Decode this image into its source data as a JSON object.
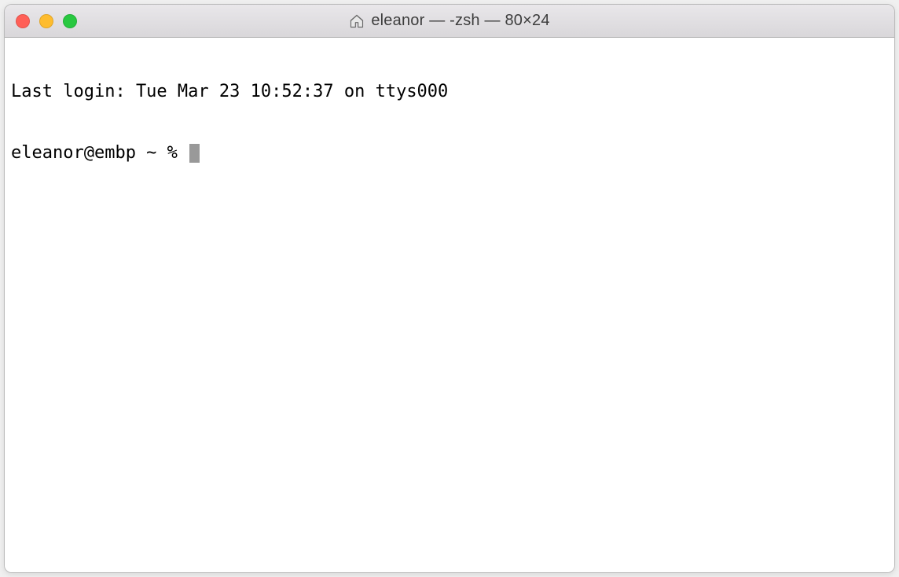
{
  "window": {
    "title": "eleanor — -zsh — 80×24"
  },
  "terminal": {
    "last_login": "Last login: Tue Mar 23 10:52:37 on ttys000",
    "prompt": "eleanor@embp ~ % "
  }
}
